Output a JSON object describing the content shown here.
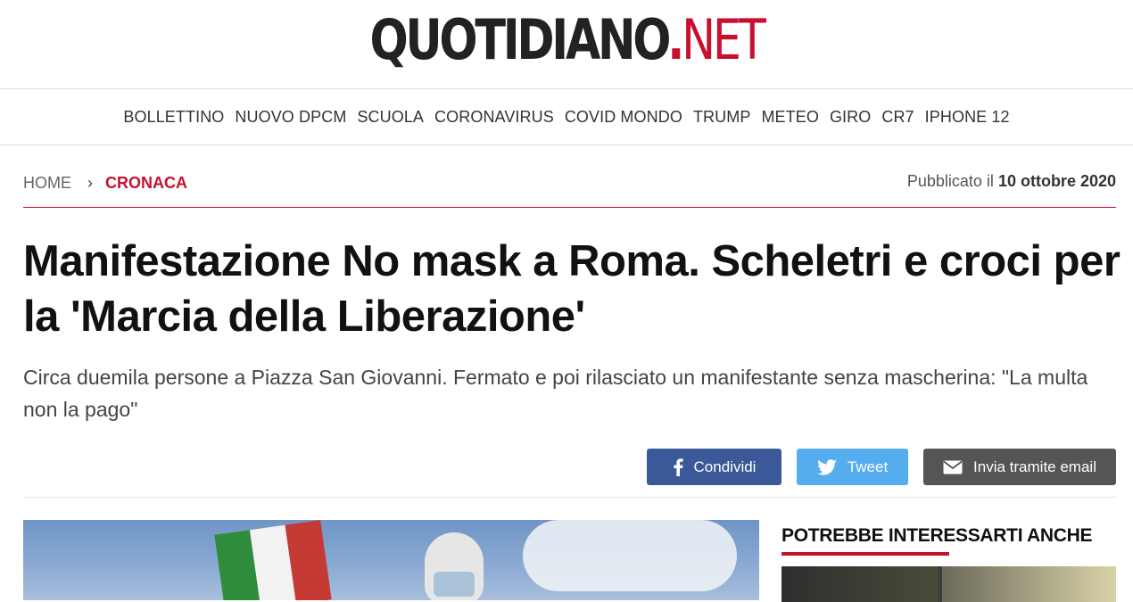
{
  "logo": {
    "brand": "QUOTIDIANO",
    "dot": ".",
    "tld": "NET"
  },
  "nav": [
    "BOLLETTINO",
    "NUOVO DPCM",
    "SCUOLA",
    "CORONAVIRUS",
    "COVID MONDO",
    "TRUMP",
    "METEO",
    "GIRO",
    "CR7",
    "IPHONE 12"
  ],
  "breadcrumb": {
    "home": "HOME",
    "separator": "›",
    "category": "CRONACA"
  },
  "published": {
    "label": "Pubblicato il",
    "date": "10 ottobre 2020"
  },
  "article": {
    "title": "Manifestazione No mask a Roma. Scheletri e croci per la 'Marcia della Liberazione'",
    "subtitle": "Circa duemila persone a Piazza San Giovanni. Fermato e poi rilasciato un manifestante senza mascherina: \"La multa non la pago\""
  },
  "share": {
    "facebook": {
      "label": "Condividi",
      "icon": "facebook-icon",
      "color": "#3b5998"
    },
    "twitter": {
      "label": "Tweet",
      "icon": "twitter-icon",
      "color": "#55acee"
    },
    "email": {
      "label": "Invia tramite email",
      "icon": "envelope-icon",
      "color": "#555555"
    }
  },
  "sidebar": {
    "title": "POTREBBE INTERESSARTI ANCHE"
  },
  "colors": {
    "accent": "#c8102e"
  }
}
